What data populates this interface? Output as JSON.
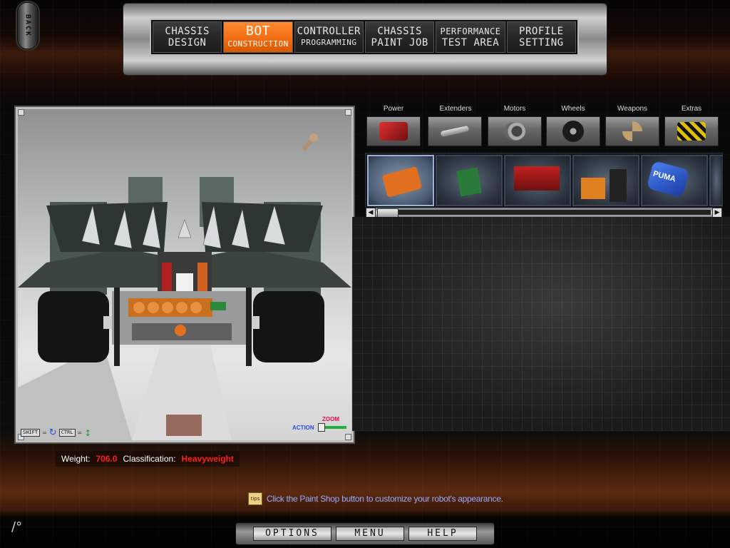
{
  "back": {
    "label": "BACK"
  },
  "topnav": {
    "tabs": [
      {
        "line1": "CHASSIS",
        "line2": "DESIGN",
        "active": false
      },
      {
        "line1": "BOT",
        "line2": "CONSTRUCTION",
        "active": true
      },
      {
        "line1": "CONTROLLER",
        "line2": "PROGRAMMING",
        "active": false
      },
      {
        "line1": "CHASSIS",
        "line2": "PAINT JOB",
        "active": false
      },
      {
        "line1": "PERFORMANCE",
        "line2": "TEST AREA",
        "active": false
      },
      {
        "line1": "PROFILE",
        "line2": "SETTING",
        "active": false
      }
    ]
  },
  "viewport": {
    "shift_key": "SHIFT",
    "ctrl_key": "CTRL",
    "zoom_label": "ZOOM",
    "action_label": "ACTION"
  },
  "stats": {
    "weight_label": "Weight:",
    "weight_value": "706.0",
    "class_label": "Classification:",
    "class_value": "Heavyweight"
  },
  "parts": {
    "categories": [
      {
        "label": "Power",
        "icon": "battery-icon",
        "color": "#c02020"
      },
      {
        "label": "Extenders",
        "icon": "extender-bar-icon",
        "color": "#b0b0b0"
      },
      {
        "label": "Motors",
        "icon": "motor-icon",
        "color": "#808080"
      },
      {
        "label": "Wheels",
        "icon": "wheel-icon",
        "color": "#202020"
      },
      {
        "label": "Weapons",
        "icon": "blade-weapon-icon",
        "color": "#a08050"
      },
      {
        "label": "Extras",
        "icon": "hazard-extra-icon",
        "color": "#d0b000"
      }
    ],
    "items": [
      {
        "icon": "orange-battery-pack-icon",
        "color": "#e07020",
        "selected": true
      },
      {
        "icon": "circuit-board-icon",
        "color": "#2a7a3a",
        "selected": false
      },
      {
        "icon": "red-battery-box-icon",
        "color": "#b02020",
        "selected": false
      },
      {
        "icon": "battery-pair-icon",
        "color": "#e08020",
        "selected": false
      },
      {
        "icon": "puma-battery-icon",
        "color": "#2050c0",
        "selected": false
      }
    ],
    "puma_text": "PUMA"
  },
  "tip": {
    "icon_text": "tips",
    "text": "Click the Paint Shop button to customize your robot's appearance."
  },
  "bottom_nav": {
    "options": "OPTIONS",
    "menu": "MENU",
    "help": "HELP"
  },
  "colors": {
    "accent": "#f26a10",
    "stat_value": "#ff2020",
    "tip_text": "#9aa8ff"
  }
}
